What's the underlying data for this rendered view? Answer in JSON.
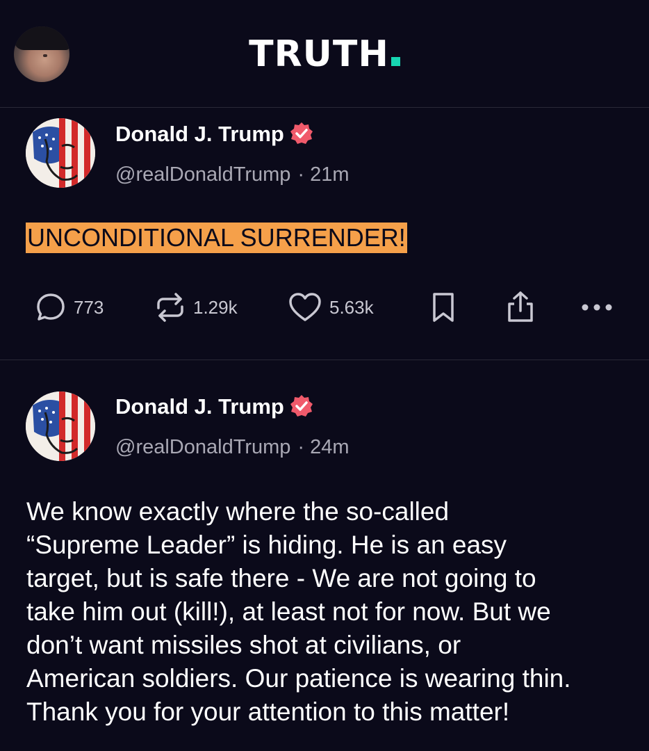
{
  "header": {
    "logo_text": "TRUTH",
    "logo_accent_color": "#17d6b2",
    "profile_icon": "user-avatar"
  },
  "posts": [
    {
      "author": {
        "name": "Donald J. Trump",
        "handle": "@realDonaldTrump",
        "verified": true,
        "verified_color": "#f05a6b",
        "avatar_icon": "flag-portrait-avatar"
      },
      "time_ago": "21m",
      "separator": "·",
      "text": "UNCONDITIONAL SURRENDER!",
      "text_highlight_color": "#f5a04a",
      "actions": {
        "replies": "773",
        "retruths": "1.29k",
        "likes": "5.63k",
        "icons": [
          "reply-icon",
          "retruth-icon",
          "like-icon",
          "bookmark-icon",
          "share-icon",
          "more-icon"
        ]
      }
    },
    {
      "author": {
        "name": "Donald J. Trump",
        "handle": "@realDonaldTrump",
        "verified": true,
        "verified_color": "#f05a6b",
        "avatar_icon": "flag-portrait-avatar"
      },
      "time_ago": "24m",
      "separator": "·",
      "text_lines": [
        "We know exactly where the so-called",
        "“Supreme Leader” is hiding. He is an easy",
        "target, but is safe there - We are not going to",
        "take him out (kill!), at least not for now. But we",
        "don’t want missiles shot at civilians, or",
        "American soldiers. Our patience is wearing thin.",
        "Thank you for your attention to this matter!"
      ]
    }
  ]
}
